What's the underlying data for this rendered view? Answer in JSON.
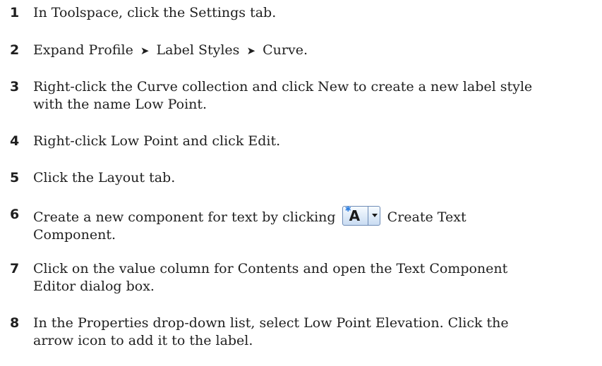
{
  "steps": [
    {
      "num": "1",
      "text": "In Toolspace, click the Settings tab."
    },
    {
      "num": "2",
      "parts": [
        "Expand Profile",
        "Label Styles",
        "Curve."
      ],
      "separator": "➤"
    },
    {
      "num": "3",
      "lines": [
        "Right-click the Curve collection and click New to create a new label style",
        "with the name Low Point."
      ]
    },
    {
      "num": "4",
      "text": "Right-click Low Point and click Edit."
    },
    {
      "num": "5",
      "text": "Click the Layout tab."
    },
    {
      "num": "6",
      "before": "Create a new component for text by clicking",
      "after": "Create Text",
      "line2": "Component.",
      "icon": "create-text-component-icon"
    },
    {
      "num": "7",
      "lines": [
        "Click on the value column for Contents and open the Text Component",
        "Editor dialog box."
      ]
    },
    {
      "num": "8",
      "lines": [
        "In the Properties drop-down list, select Low Point Elevation. Click the",
        "arrow icon to add it to the label."
      ]
    }
  ]
}
